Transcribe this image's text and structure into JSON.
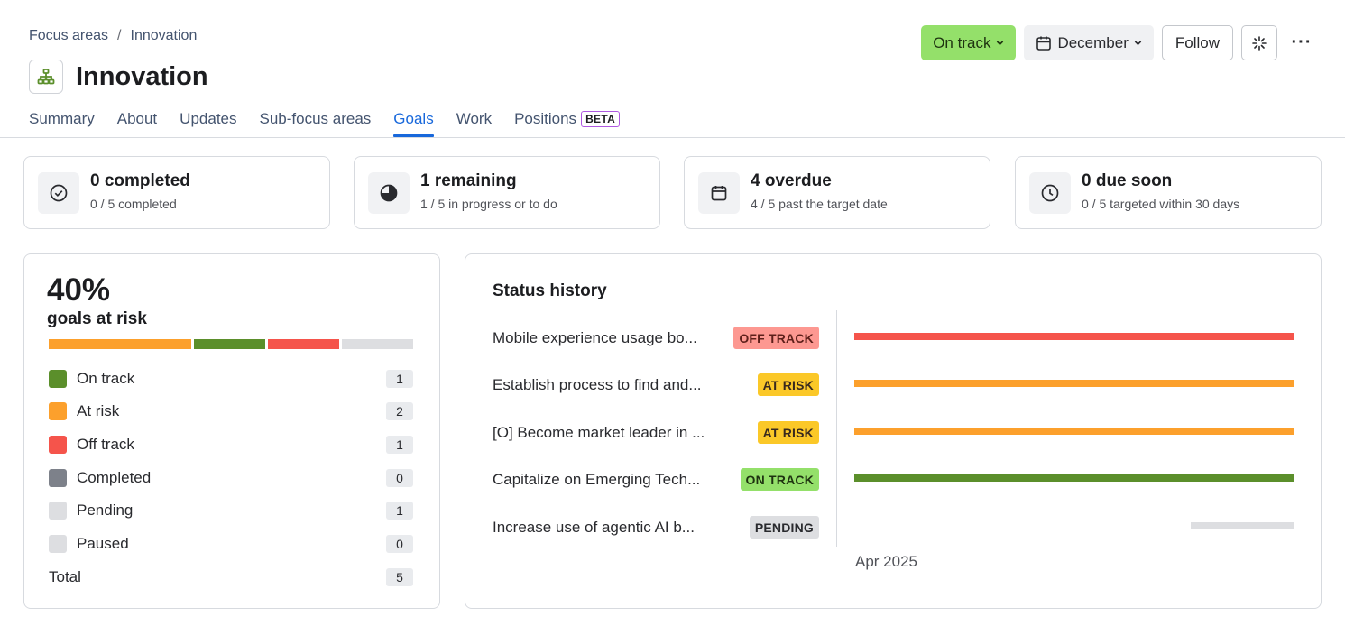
{
  "breadcrumb": {
    "items": [
      "Focus areas",
      "Innovation"
    ],
    "separator": "/"
  },
  "page_title": "Innovation",
  "actions": {
    "status_label": "On track",
    "date_label": "December",
    "follow_label": "Follow",
    "more_label": "···"
  },
  "tabs": [
    {
      "label": "Summary"
    },
    {
      "label": "About"
    },
    {
      "label": "Updates"
    },
    {
      "label": "Sub-focus areas"
    },
    {
      "label": "Goals",
      "active": true
    },
    {
      "label": "Work"
    },
    {
      "label": "Positions",
      "badge": "BETA"
    }
  ],
  "stats": [
    {
      "icon": "check-circle-icon",
      "title": "0 completed",
      "sub": "0 / 5 completed"
    },
    {
      "icon": "pie-chart-icon",
      "title": "1 remaining",
      "sub": "1 / 5 in progress or to do"
    },
    {
      "icon": "calendar-icon",
      "title": "4 overdue",
      "sub": "4 / 5 past the target date"
    },
    {
      "icon": "clock-icon",
      "title": "0 due soon",
      "sub": "0 / 5 targeted within 30 days"
    }
  ],
  "risk": {
    "percent": "40%",
    "label": "goals at risk",
    "bar_segments": [
      {
        "status": "At risk",
        "count": 2,
        "color": "#fca02c"
      },
      {
        "status": "On track",
        "count": 1,
        "color": "#5b8f2b"
      },
      {
        "status": "Off track",
        "count": 1,
        "color": "#f5544b"
      },
      {
        "status": "Pending",
        "count": 1,
        "color": "#dddee1"
      }
    ],
    "legend": [
      {
        "label": "On track",
        "count": "1",
        "color": "#5b8f2b"
      },
      {
        "label": "At risk",
        "count": "2",
        "color": "#fca02c"
      },
      {
        "label": "Off track",
        "count": "1",
        "color": "#f5544b"
      },
      {
        "label": "Completed",
        "count": "0",
        "color": "#7d818a"
      },
      {
        "label": "Pending",
        "count": "1",
        "color": "#dddee1"
      },
      {
        "label": "Paused",
        "count": "0",
        "color": "#dddee1"
      }
    ],
    "total_label": "Total",
    "total_count": "5"
  },
  "history": {
    "title": "Status history",
    "axis_label": "Apr 2025",
    "rows": [
      {
        "name": "Mobile experience usage bo...",
        "status": "OFF TRACK",
        "lozenge_bg": "#fd9891",
        "lozenge_fg": "#5d1f1a",
        "bar_color": "#f5544b",
        "bar_start": 0.0,
        "bar_end": 1.0
      },
      {
        "name": "Establish process to find and...",
        "status": "AT RISK",
        "lozenge_bg": "#fbc828",
        "lozenge_fg": "#38291e",
        "bar_color": "#fca02c",
        "bar_start": 0.0,
        "bar_end": 1.0
      },
      {
        "name": "[O] Become market leader in ...",
        "status": "AT RISK",
        "lozenge_bg": "#fbc828",
        "lozenge_fg": "#38291e",
        "bar_color": "#fca02c",
        "bar_start": 0.0,
        "bar_end": 1.0
      },
      {
        "name": "Capitalize on Emerging Tech...",
        "status": "ON TRACK",
        "lozenge_bg": "#94e06a",
        "lozenge_fg": "#1e3310",
        "bar_color": "#5b8f2b",
        "bar_start": 0.0,
        "bar_end": 1.0
      },
      {
        "name": "Increase use of agentic AI b...",
        "status": "PENDING",
        "lozenge_bg": "#dddee1",
        "lozenge_fg": "#292a2e",
        "bar_color": "#dddee1",
        "bar_start": 0.766,
        "bar_end": 1.0
      }
    ]
  }
}
